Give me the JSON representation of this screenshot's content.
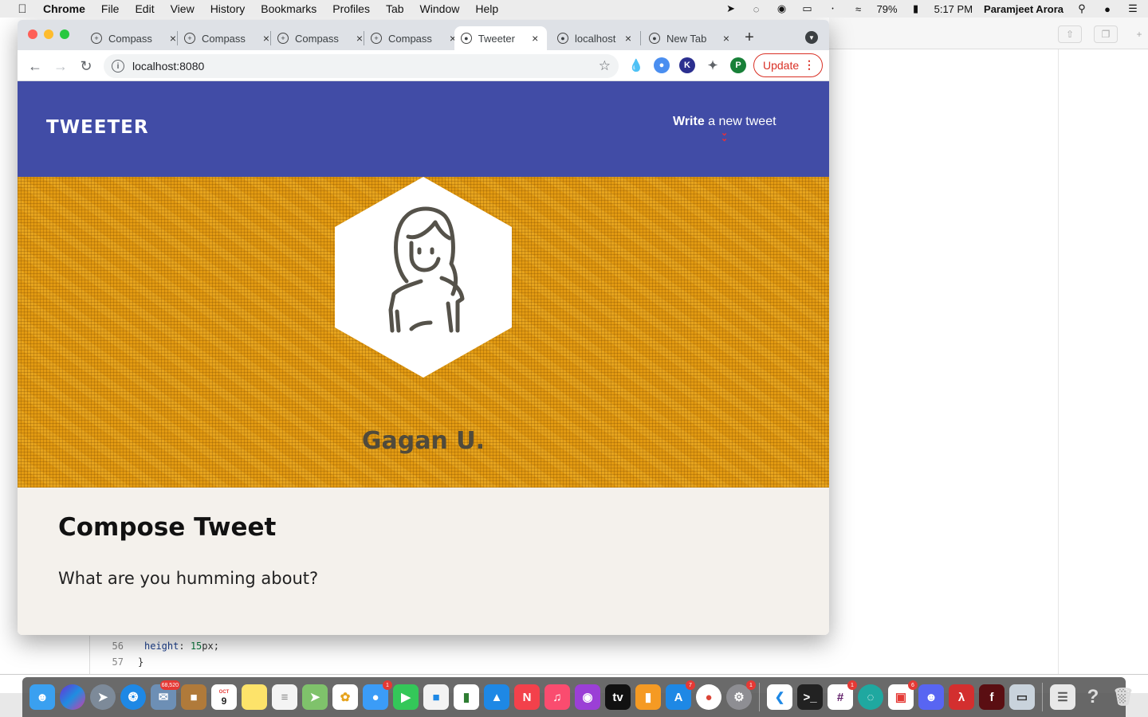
{
  "menubar": {
    "app_name": "Chrome",
    "items": [
      "File",
      "Edit",
      "View",
      "History",
      "Bookmarks",
      "Profiles",
      "Tab",
      "Window",
      "Help"
    ],
    "battery": "79%",
    "time": "5:17 PM",
    "user": "Paramjeet Arora"
  },
  "browser": {
    "tabs": [
      {
        "title": "Compass",
        "icon": "compass-icon",
        "active": false
      },
      {
        "title": "Compass",
        "icon": "compass-icon",
        "active": false
      },
      {
        "title": "Compass",
        "icon": "compass-icon",
        "active": false
      },
      {
        "title": "Compass",
        "icon": "compass-icon",
        "active": false
      },
      {
        "title": "Tweeter",
        "icon": "globe-icon",
        "active": true
      },
      {
        "title": "localhost",
        "icon": "globe-icon",
        "active": false
      },
      {
        "title": "New Tab",
        "icon": "chrome-icon",
        "active": false
      }
    ],
    "url": "localhost:8080",
    "update_label": "Update",
    "profile_initial": "P",
    "extension_k": "K"
  },
  "site": {
    "brand": "TWEETER",
    "compose_toggle_bold": "Write",
    "compose_toggle_rest": " a new tweet",
    "profile_name": "Gagan U.",
    "compose_heading": "Compose Tweet",
    "compose_placeholder": "What are you humming about?"
  },
  "editor": {
    "lines": [
      {
        "number": "56",
        "prop": "height",
        "value": "15",
        "unit": "px;"
      },
      {
        "number": "57",
        "text": "}"
      }
    ]
  },
  "dock": {
    "badges": {
      "mail": "68,520",
      "calendar_month": "OCT",
      "calendar_day": "9",
      "messages": "1",
      "appstore": "7",
      "prefs": "1",
      "slack": "1",
      "games": "6"
    }
  },
  "colors": {
    "nav_bg": "#414ca6",
    "profile_bg": "#e29a12",
    "compose_bg": "#f4f1ec",
    "chevron": "#e8303a"
  }
}
